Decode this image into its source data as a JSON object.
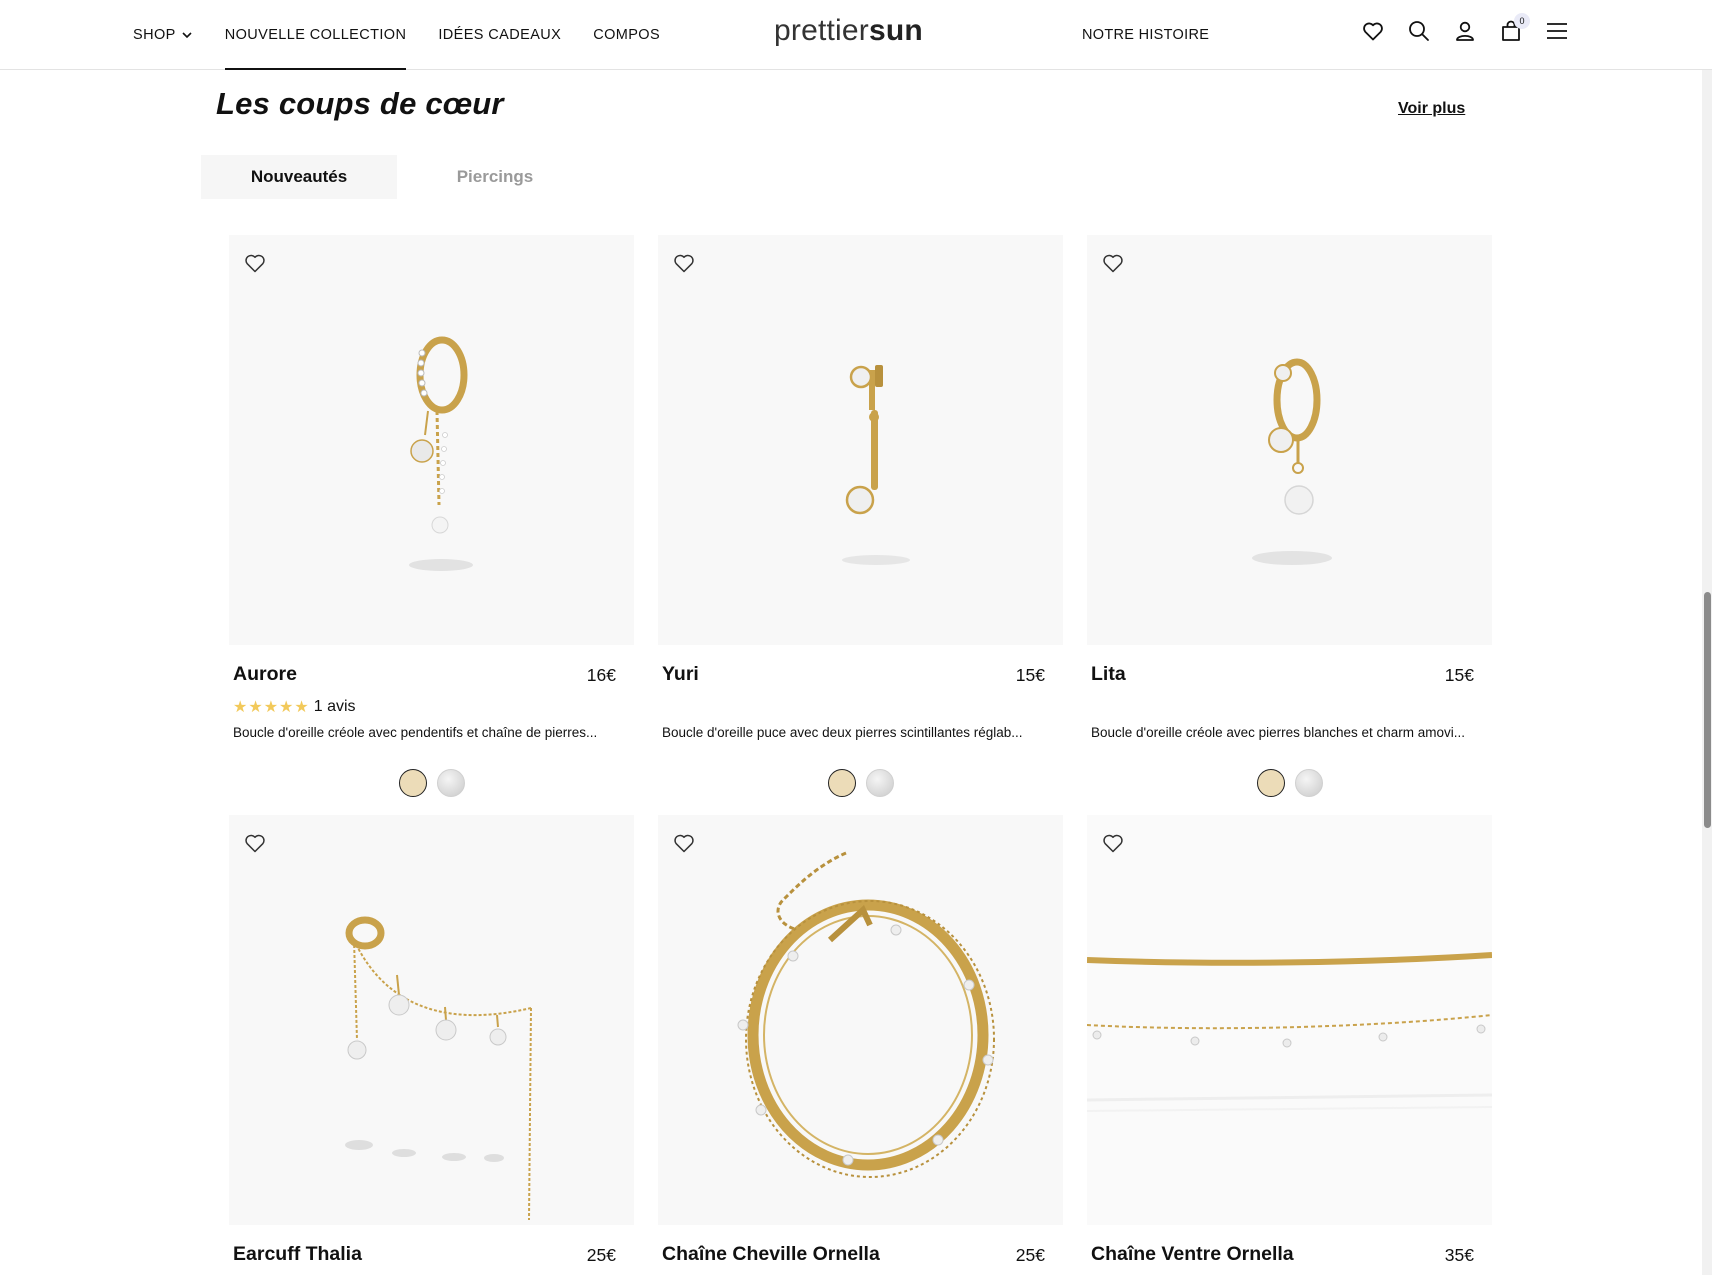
{
  "header": {
    "nav_left": [
      {
        "label": "SHOP",
        "has_chevron": true
      },
      {
        "label": "NOUVELLE COLLECTION",
        "active": true
      },
      {
        "label": "IDÉES CADEAUX"
      },
      {
        "label": "COMPOS"
      }
    ],
    "logo_light": "prettier",
    "logo_bold": "sun",
    "nav_right": "NOTRE HISTOIRE",
    "cart_count": "0",
    "icons": [
      "heart-icon",
      "search-icon",
      "user-icon",
      "bag-icon",
      "menu-icon"
    ]
  },
  "section": {
    "title": "Les coups de cœur",
    "voir_plus": "Voir plus",
    "tabs": [
      {
        "label": "Nouveautés",
        "active": true
      },
      {
        "label": "Piercings",
        "active": false
      }
    ]
  },
  "products": [
    {
      "name": "Aurore",
      "price": "16€",
      "stars": "★★★★★",
      "reviews": "1 avis",
      "description": "Boucle d'oreille créole avec pendentifs et chaîne de pierres..."
    },
    {
      "name": "Yuri",
      "price": "15€",
      "description": "Boucle d'oreille puce avec deux pierres scintillantes réglab..."
    },
    {
      "name": "Lita",
      "price": "15€",
      "description": "Boucle d'oreille créole avec pierres blanches et charm amovi..."
    },
    {
      "name": "Earcuff Thalia",
      "price": "25€"
    },
    {
      "name": "Chaîne Cheville Ornella",
      "price": "25€"
    },
    {
      "name": "Chaîne Ventre Ornella",
      "price": "35€"
    }
  ],
  "colors": {
    "gold_swatch": "#ecdcb8",
    "gold_metal": "#c9a24b",
    "card_bg": "#f8f8f8",
    "star": "#f2c95a"
  }
}
